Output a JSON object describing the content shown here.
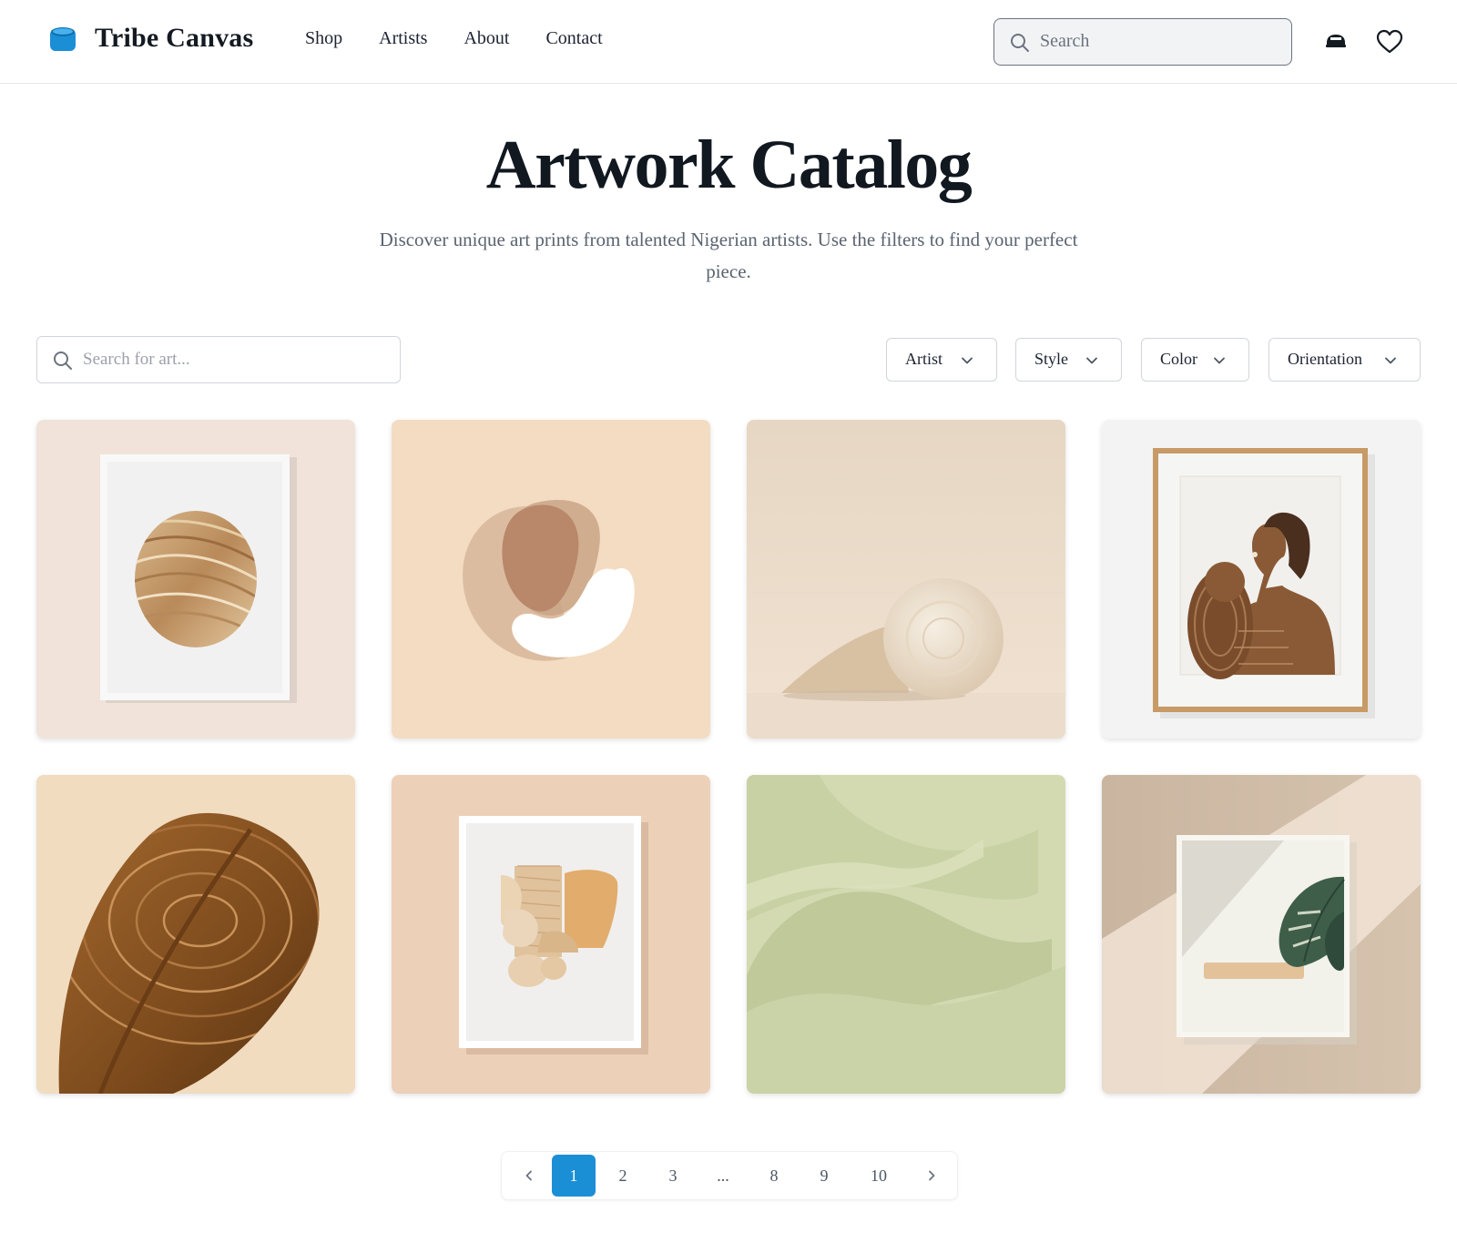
{
  "header": {
    "brand": "Tribe Canvas",
    "nav": [
      {
        "label": "Shop"
      },
      {
        "label": "Artists"
      },
      {
        "label": "About"
      },
      {
        "label": "Contact"
      }
    ],
    "search_placeholder": "Search",
    "icons": [
      "search-icon",
      "cart-icon",
      "heart-icon"
    ]
  },
  "hero": {
    "title": "Artwork Catalog",
    "subtitle": "Discover unique art prints from talented Nigerian artists. Use the filters to find your perfect piece."
  },
  "filters": {
    "search_placeholder": "Search for art...",
    "dropdowns": [
      {
        "label": "Artist"
      },
      {
        "label": "Style"
      },
      {
        "label": "Color"
      },
      {
        "label": "Orientation"
      }
    ]
  },
  "artworks": [
    {
      "name": "framed-agate-circle-print"
    },
    {
      "name": "abstract-organic-shapes-print"
    },
    {
      "name": "sculptural-sphere-print"
    },
    {
      "name": "framed-tribal-portrait-print"
    },
    {
      "name": "carved-leaf-print"
    },
    {
      "name": "framed-collage-shapes-print"
    },
    {
      "name": "sage-waves-print"
    },
    {
      "name": "monstera-shadow-print"
    }
  ],
  "pagination": {
    "pages": [
      "1",
      "2",
      "3",
      "...",
      "8",
      "9",
      "10"
    ],
    "current": "1"
  },
  "colors": {
    "accent": "#1b8fd6",
    "text": "#141a22",
    "muted": "#5a6370"
  }
}
